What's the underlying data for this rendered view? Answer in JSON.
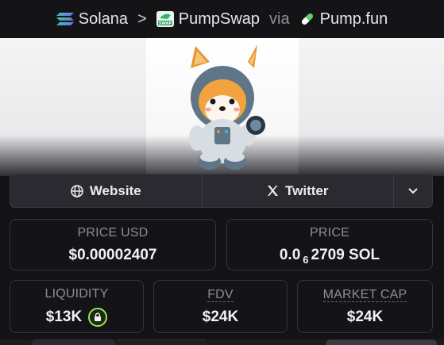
{
  "breadcrumb": {
    "chain": "Solana",
    "separator": ">",
    "dex": "PumpSwap",
    "via": "via",
    "launchpad": "Pump.fun",
    "swap_icon_text": "SWAP"
  },
  "links": {
    "website": "Website",
    "twitter": "Twitter"
  },
  "stats": {
    "price_usd_label": "PRICE USD",
    "price_usd_value": "$0.00002407",
    "price_label": "PRICE",
    "price_prefix": "0.0",
    "price_subscript": "6",
    "price_suffix": "2709 SOL",
    "liquidity_label": "LIQUIDITY",
    "liquidity_value": "$13K",
    "fdv_label": "FDV",
    "fdv_value": "$24K",
    "market_cap_label": "MARKET CAP",
    "market_cap_value": "$24K"
  },
  "icons": {
    "chain": "solana-icon",
    "dex": "pumpswap-icon",
    "launchpad": "pill-icon",
    "website": "globe-icon",
    "twitter": "x-icon",
    "more": "chevron-down-icon",
    "liquidity_lock": "lock-icon"
  },
  "colors": {
    "background": "#131316",
    "accent_lock": "#9be25a",
    "solana_gradient": [
      "#9945ff",
      "#14f195"
    ]
  }
}
